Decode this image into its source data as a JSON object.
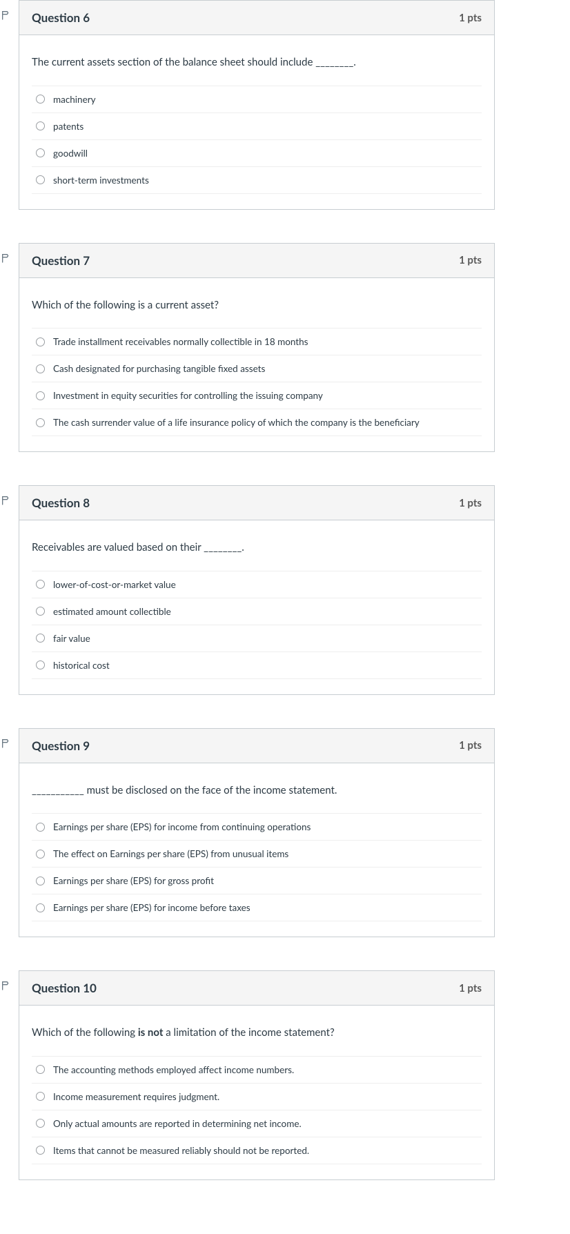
{
  "questions": [
    {
      "title": "Question 6",
      "pts": "1 pts",
      "text_html": "The current assets section of the balance sheet should include ________.",
      "answers": [
        "machinery",
        "patents",
        "goodwill",
        "short-term investments"
      ]
    },
    {
      "title": "Question 7",
      "pts": "1 pts",
      "text_html": "Which of the following is a current asset?",
      "answers": [
        "Trade installment receivables normally collectible in 18 months",
        "Cash designated for purchasing tangible fixed assets",
        "Investment in equity securities for controlling the issuing company",
        "The cash surrender value of a life insurance policy of which the company is the beneficiary"
      ]
    },
    {
      "title": "Question 8",
      "pts": "1 pts",
      "text_html": "Receivables are valued based on their ________.",
      "answers": [
        "lower-of-cost-or-market value",
        "estimated amount collectible",
        "fair value",
        "historical cost"
      ]
    },
    {
      "title": "Question 9",
      "pts": "1 pts",
      "text_html": "___________ must be disclosed on the face of the income statement.",
      "answers": [
        "Earnings per share (EPS) for income from continuing operations",
        "The effect on Earnings per share (EPS) from unusual items",
        "Earnings per share (EPS) for gross profit",
        "Earnings per share (EPS) for income before taxes"
      ]
    },
    {
      "title": "Question 10",
      "pts": "1 pts",
      "text_html": "Which of the following <strong>is not</strong> a limitation of the income statement?",
      "answers": [
        "The accounting methods employed affect income numbers.",
        "Income measurement requires judgment.",
        "Only actual amounts are reported in determining net income.",
        "Items that cannot be measured reliably should not be reported."
      ]
    }
  ]
}
